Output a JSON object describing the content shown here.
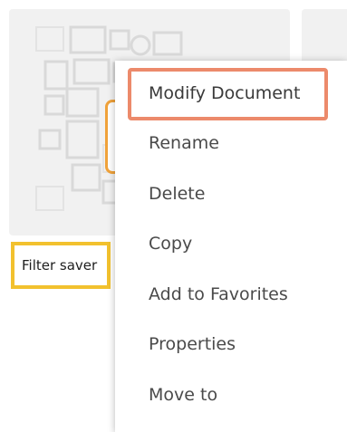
{
  "document_tile": {
    "name": "Filter saver",
    "thumbnail_icon": "dashboard-layout-icon"
  },
  "context_menu": {
    "items": [
      {
        "label": "Modify Document"
      },
      {
        "label": "Rename"
      },
      {
        "label": "Delete"
      },
      {
        "label": "Copy"
      },
      {
        "label": "Add to Favorites"
      },
      {
        "label": "Properties"
      },
      {
        "label": "Move to"
      }
    ]
  },
  "colors": {
    "highlight_modify": "#ec8a6b",
    "highlight_name": "#f2c12e",
    "thumbnail_accent": "#f0a23a"
  }
}
